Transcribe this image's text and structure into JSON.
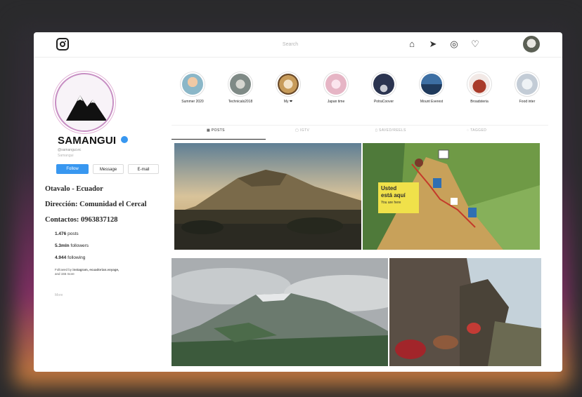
{
  "topbar": {
    "search_placeholder": "Search",
    "icons": [
      "home-icon",
      "send-icon",
      "explore-icon",
      "heart-icon"
    ]
  },
  "profile": {
    "username": "SAMANGUI",
    "handle": "@samangui.ec",
    "sub_handle": "Samangui",
    "buttons": {
      "follow": "Follow",
      "message": "Message",
      "email": "E-mail"
    },
    "bio": {
      "location": "Otavalo - Ecuador",
      "address": "Dirección: Comunidad el Cercal",
      "contact": "Contactos: 0963837128"
    },
    "stats": {
      "posts_value": "1.476",
      "posts_label": "posts",
      "followers_value": "5.3mln",
      "followers_label": "followers",
      "following_value": "4.944",
      "following_label": "following"
    },
    "category_prefix": "Followed by ",
    "category_names": "instagram, ecuadorian.voyage,",
    "category_suffix": "and 155 more",
    "extra": "More"
  },
  "stories": [
    {
      "label": "Summer 2020",
      "color": "#8bb7c8"
    },
    {
      "label": "Technicals2018",
      "color": "#9aa3a0"
    },
    {
      "label": "My ❤",
      "color": "#c79b5a"
    },
    {
      "label": "Japan time",
      "color": "#e6b5c5"
    },
    {
      "label": "PotraCoover",
      "color": "#2b3450"
    },
    {
      "label": "Mount Everest",
      "color": "#1f3a5c"
    },
    {
      "label": "Broadsteria",
      "color": "#a93b2a"
    },
    {
      "label": "Food inter",
      "color": "#c3ccd6"
    }
  ],
  "tabs": [
    {
      "label": "POSTS",
      "active": true
    },
    {
      "label": "IGTV",
      "active": false
    },
    {
      "label": "SAVED/REELS",
      "active": false
    },
    {
      "label": "TAGGED",
      "active": false
    }
  ],
  "grid": {
    "photo2_callout_line1": "Usted",
    "photo2_callout_line2": "está aquí",
    "photo2_callout_line3": "You are here"
  }
}
